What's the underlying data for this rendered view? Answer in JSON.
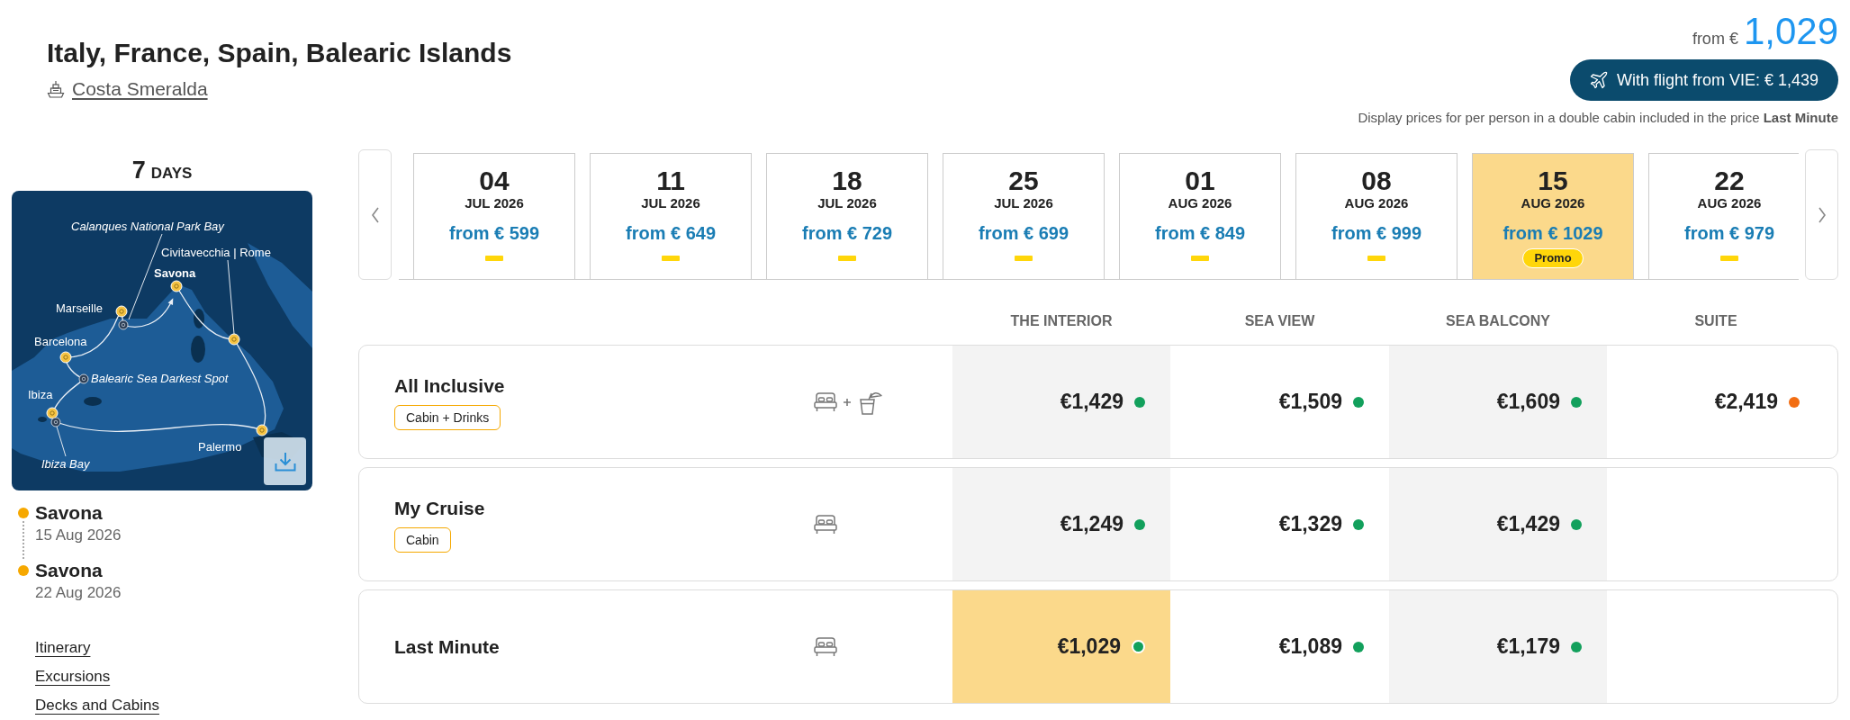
{
  "header": {
    "title": "Italy, France, Spain, Balearic Islands",
    "ship": "Costa Smeralda",
    "price_prefix": "from €",
    "price_amount": "1,029",
    "flight_button": "With flight from VIE: € 1,439",
    "price_note": "Display prices for per person in a double cabin included in the price **Last Minute**"
  },
  "duration": {
    "number": "7",
    "unit": "DAYS"
  },
  "map": {
    "labels": [
      {
        "text": "Calanques National Park Bay",
        "kind": "stop"
      },
      {
        "text": "Civitavecchia | Rome",
        "kind": "port"
      },
      {
        "text": "Savona",
        "kind": "home"
      },
      {
        "text": "Marseille",
        "kind": "port"
      },
      {
        "text": "Barcelona",
        "kind": "port"
      },
      {
        "text": "Balearic Sea Darkest Spot",
        "kind": "stop"
      },
      {
        "text": "Ibiza",
        "kind": "port"
      },
      {
        "text": "Palermo",
        "kind": "port"
      },
      {
        "text": "Ibiza Bay",
        "kind": "stop"
      }
    ]
  },
  "timeline": [
    {
      "port": "Savona",
      "date": "15 Aug 2026"
    },
    {
      "port": "Savona",
      "date": "22 Aug 2026"
    }
  ],
  "links": [
    "Itinerary",
    "Excursions",
    "Decks and Cabins"
  ],
  "dates": [
    {
      "day": "04",
      "month": "JUL 2026",
      "price": "from € 599",
      "selected": false
    },
    {
      "day": "11",
      "month": "JUL 2026",
      "price": "from € 649",
      "selected": false
    },
    {
      "day": "18",
      "month": "JUL 2026",
      "price": "from € 729",
      "selected": false
    },
    {
      "day": "25",
      "month": "JUL 2026",
      "price": "from € 699",
      "selected": false
    },
    {
      "day": "01",
      "month": "AUG 2026",
      "price": "from € 849",
      "selected": false
    },
    {
      "day": "08",
      "month": "AUG 2026",
      "price": "from € 999",
      "selected": false
    },
    {
      "day": "15",
      "month": "AUG 2026",
      "price": "from € 1029",
      "selected": true,
      "badge": "Promo"
    },
    {
      "day": "22",
      "month": "AUG 2026",
      "price": "from € 979",
      "selected": false
    }
  ],
  "table": {
    "columns": [
      "THE INTERIOR",
      "SEA VIEW",
      "SEA BALCONY",
      "SUITE"
    ],
    "rows": [
      {
        "name": "All Inclusive",
        "tag": "Cabin + Drinks",
        "kind": "package",
        "prices": [
          {
            "price": "€1,429",
            "color": "#12a05c",
            "selected": false
          },
          {
            "price": "€1,509",
            "color": "#12a05c",
            "selected": false
          },
          {
            "price": "€1,609",
            "color": "#12a05c",
            "selected": false
          },
          {
            "price": "€2,419",
            "color": "#f26d12",
            "selected": false
          }
        ]
      },
      {
        "name": "My Cruise",
        "tag": "Cabin",
        "kind": "cabin",
        "prices": [
          {
            "price": "€1,249",
            "color": "#12a05c",
            "selected": false
          },
          {
            "price": "€1,329",
            "color": "#12a05c",
            "selected": false
          },
          {
            "price": "€1,429",
            "color": "#12a05c",
            "selected": false
          }
        ]
      },
      {
        "name": "Last Minute",
        "kind": "cabin",
        "prices": [
          {
            "price": "€1,029",
            "color": "#12a05c",
            "selected": true
          },
          {
            "price": "€1,089",
            "color": "#12a05c",
            "selected": false
          },
          {
            "price": "€1,179",
            "color": "#12a05c",
            "selected": false
          }
        ]
      }
    ]
  }
}
